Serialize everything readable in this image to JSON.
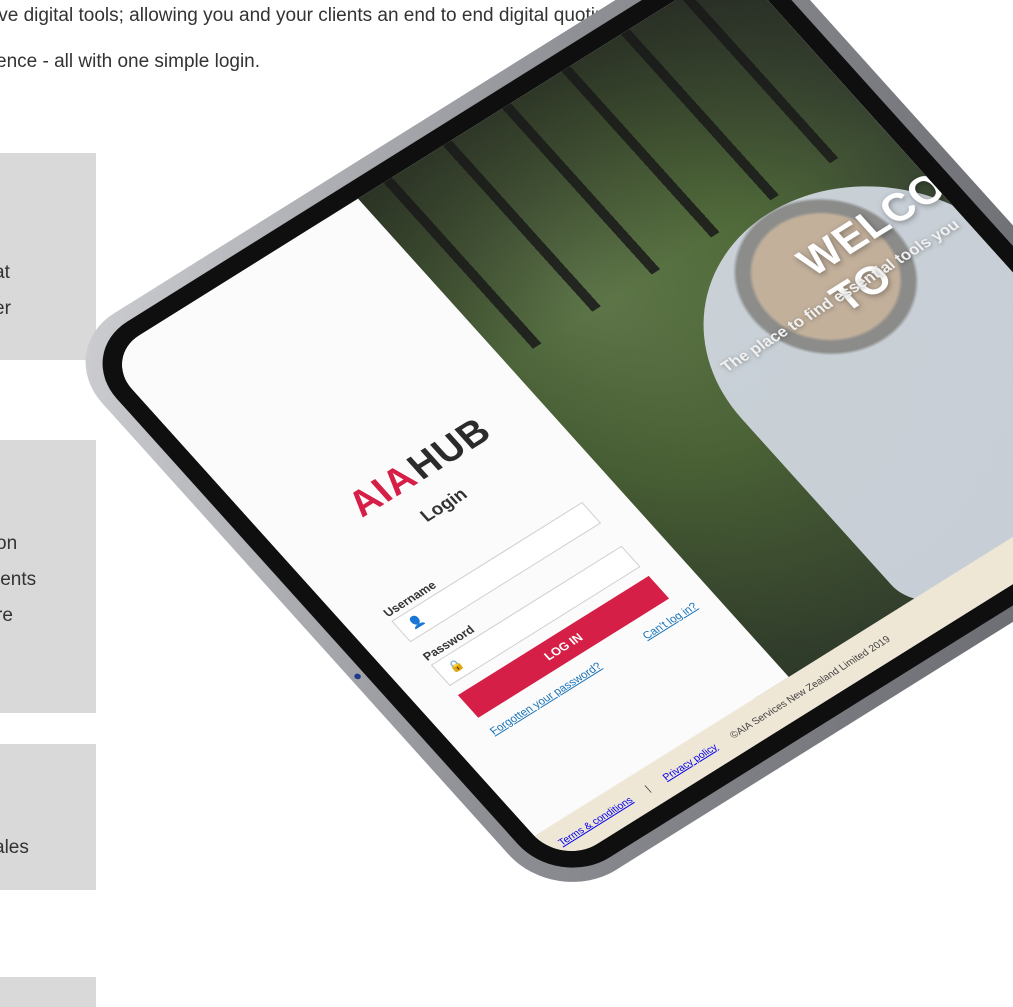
{
  "intro": {
    "line1": "ive digital tools; allowing you and your clients an end to end digital quoting,",
    "line2": "ence - all with one simple login."
  },
  "cards": [
    {
      "lines": [
        "at",
        "er"
      ]
    },
    {
      "lines": [
        "on",
        "ients",
        "re"
      ]
    },
    {
      "lines": [
        "ales"
      ]
    },
    {
      "lines": []
    }
  ],
  "tablet": {
    "login": {
      "brand_primary": "AIA",
      "brand_secondary": "HUB",
      "title": "Login",
      "username_label": "Username",
      "username_placeholder": "",
      "password_label": "Password",
      "password_placeholder": "",
      "button": "LOG IN",
      "forgot": "Forgotten your password?",
      "cant_login": "Can't log in?"
    },
    "hero": {
      "welcome": "WELCOME TO",
      "subtitle": "The place to find essential tools you"
    },
    "footer": {
      "terms": "Terms & conditions",
      "privacy": "Privacy policy",
      "copyright": "©AIA Services New Zealand Limited 2019"
    },
    "colors": {
      "brand": "#d51f46",
      "footer_bg": "#efe7d6",
      "link": "#1a73b8"
    }
  }
}
